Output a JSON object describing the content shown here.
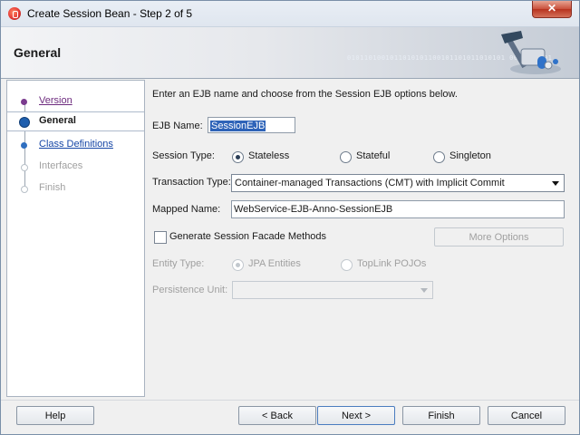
{
  "window": {
    "title": "Create Session Bean - Step 2 of 5",
    "close_glyph": "✕"
  },
  "header": {
    "title": "General",
    "bits": "0101101001011010101100101101011010101 0010110101"
  },
  "nav": {
    "items": [
      {
        "label": "Version",
        "state": "visited"
      },
      {
        "label": "General",
        "state": "current"
      },
      {
        "label": "Class Definitions",
        "state": "link"
      },
      {
        "label": "Interfaces",
        "state": "disabled"
      },
      {
        "label": "Finish",
        "state": "disabled"
      }
    ]
  },
  "form": {
    "instructions": "Enter an EJB name and choose from the Session EJB options below.",
    "ejb_name_label": "EJB Name:",
    "ejb_name_value": "SessionEJB",
    "session_type_label": "Session Type:",
    "session_types": [
      {
        "label": "Stateless",
        "selected": true
      },
      {
        "label": "Stateful",
        "selected": false
      },
      {
        "label": "Singleton",
        "selected": false
      }
    ],
    "transaction_type_label": "Transaction Type:",
    "transaction_type_value": "Container-managed Transactions (CMT) with Implicit Commit",
    "mapped_name_label": "Mapped Name:",
    "mapped_name_value": "WebService-EJB-Anno-SessionEJB",
    "facade_checkbox_label": "Generate Session Facade Methods",
    "facade_checked": false,
    "more_options_label": "More Options",
    "entity_type_label": "Entity Type:",
    "entity_types": [
      {
        "label": "JPA Entities",
        "selected": true
      },
      {
        "label": "TopLink POJOs",
        "selected": false
      }
    ],
    "persistence_unit_label": "Persistence Unit:",
    "persistence_unit_value": ""
  },
  "footer": {
    "help_label": "Help",
    "back_label": "< Back",
    "next_label": "Next >",
    "finish_label": "Finish",
    "cancel_label": "Cancel"
  }
}
